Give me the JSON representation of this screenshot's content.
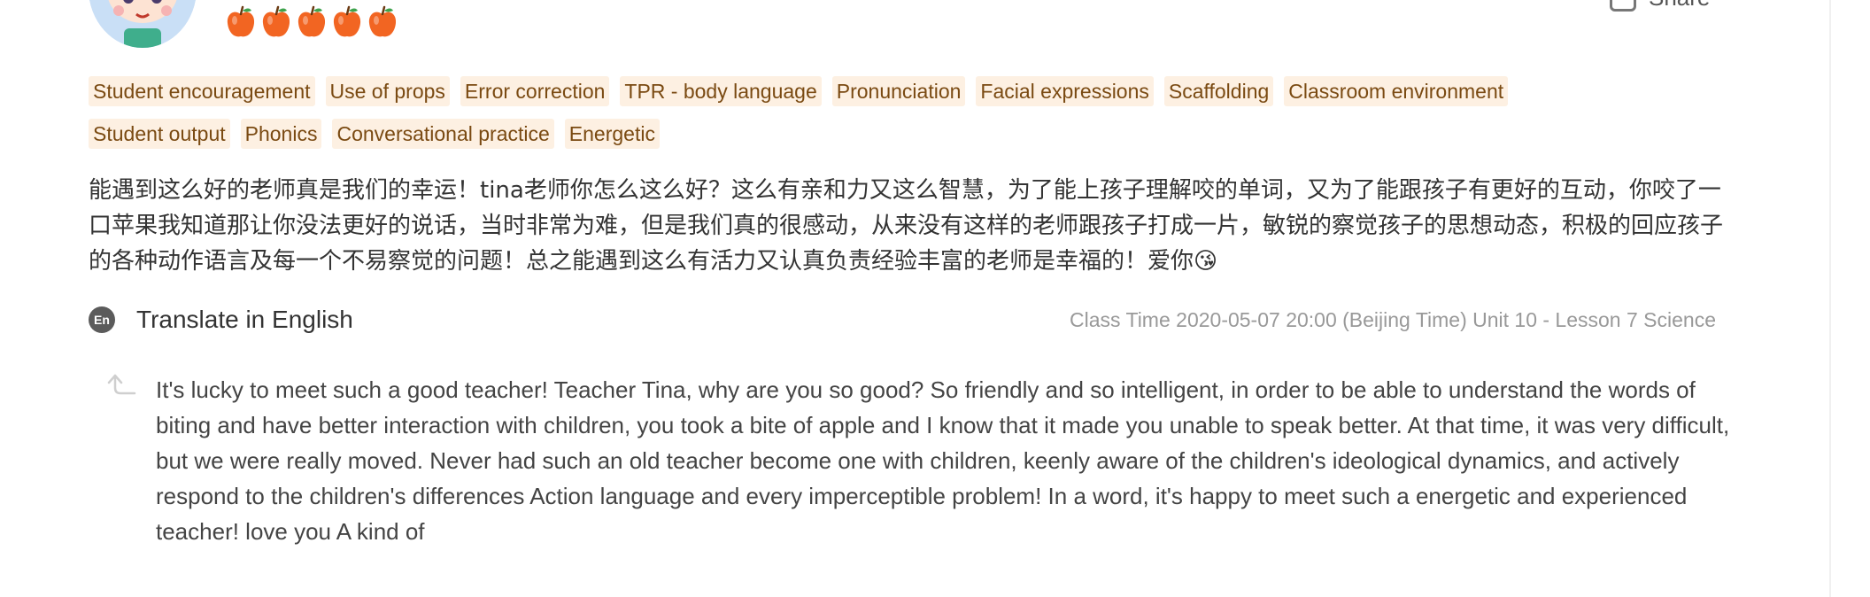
{
  "header": {
    "rating_value": 5,
    "rating_max": 5,
    "rating_icon": "apple-icon",
    "share_label": "Share"
  },
  "tags": [
    [
      "Student encouragement",
      "Use of props",
      "Error correction",
      "TPR - body language",
      "Pronunciation",
      "Facial expressions",
      "Scaffolding",
      "Classroom environment"
    ],
    [
      "Student output",
      "Phonics",
      "Conversational practice",
      "Energetic"
    ]
  ],
  "review": {
    "text": "能遇到这么好的老师真是我们的幸运！tina老师你怎么这么好？这么有亲和力又这么智慧，为了能上孩子理解咬的单词，又为了能跟孩子有更好的互动，你咬了一口苹果我知道那让你没法更好的说话，当时非常为难，但是我们真的很感动，从来没有这样的老师跟孩子打成一片，敏锐的察觉孩子的思想动态，积极的回应孩子的各种动作语言及每一个不易察觉的问题！总之能遇到这么有活力又认真负责经验丰富的老师是幸福的！爱你😘"
  },
  "translate": {
    "icon_text": "En",
    "label": "Translate in English"
  },
  "class_info": "Class Time 2020-05-07 20:00 (Beijing Time) Unit 10 - Lesson 7 Science",
  "translation": {
    "text": "It's lucky to meet such a good teacher! Teacher Tina, why are you so good? So friendly and so intelligent, in order to be able to understand the words of biting and have better interaction with children, you took a bite of apple and I know that it made you unable to speak better. At that time, it was very difficult, but we were really moved. Never had such an old teacher become one with children, keenly aware of the children's ideological dynamics, and actively respond to the children's differences Action language and every imperceptible problem! In a word, it's happy to meet such a energetic and experienced teacher! love you A kind of"
  },
  "colors": {
    "tag_bg": "#fdf0e2",
    "tag_text": "#7a4a12",
    "apple": "#f26522",
    "muted": "#999999"
  }
}
